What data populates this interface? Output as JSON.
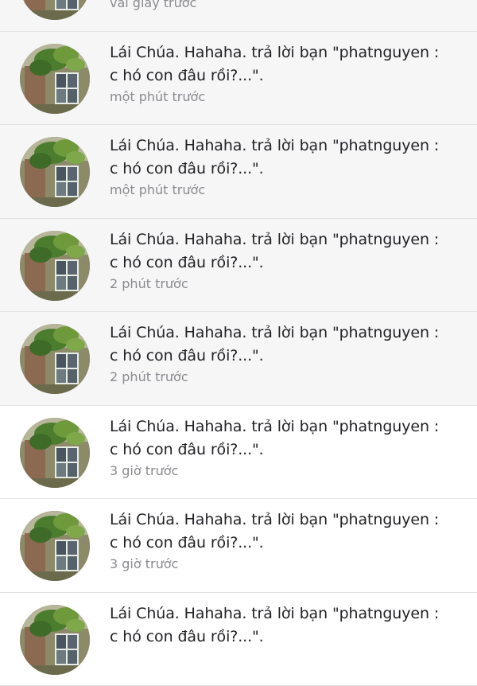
{
  "notifications": [
    {
      "line1": "",
      "line2": "",
      "time": "vài giây trước",
      "unread": true
    },
    {
      "line1": "Lái Chúa. Hahaha. trả lời bạn \"phatnguyen :",
      "line2": "c hó con đâu rồi?...\".",
      "time": "một phút trước",
      "unread": true
    },
    {
      "line1": "Lái Chúa. Hahaha. trả lời bạn \"phatnguyen :",
      "line2": "c hó con đâu rồi?...\".",
      "time": "một phút trước",
      "unread": true
    },
    {
      "line1": "Lái Chúa. Hahaha. trả lời bạn \"phatnguyen :",
      "line2": "c hó con đâu rồi?...\".",
      "time": "2 phút trước",
      "unread": true
    },
    {
      "line1": "Lái Chúa. Hahaha. trả lời bạn \"phatnguyen :",
      "line2": "c hó con đâu rồi?...\".",
      "time": "2 phút trước",
      "unread": true
    },
    {
      "line1": "Lái Chúa. Hahaha. trả lời bạn \"phatnguyen :",
      "line2": "c hó con đâu rồi?...\".",
      "time": "3 giờ trước",
      "unread": false
    },
    {
      "line1": "Lái Chúa. Hahaha. trả lời bạn \"phatnguyen :",
      "line2": "c hó con đâu rồi?...\".",
      "time": "3 giờ trước",
      "unread": false
    },
    {
      "line1": "Lái Chúa. Hahaha. trả lời bạn \"phatnguyen :",
      "line2": "c hó con đâu rồi?...\".",
      "time": "",
      "unread": false
    }
  ]
}
